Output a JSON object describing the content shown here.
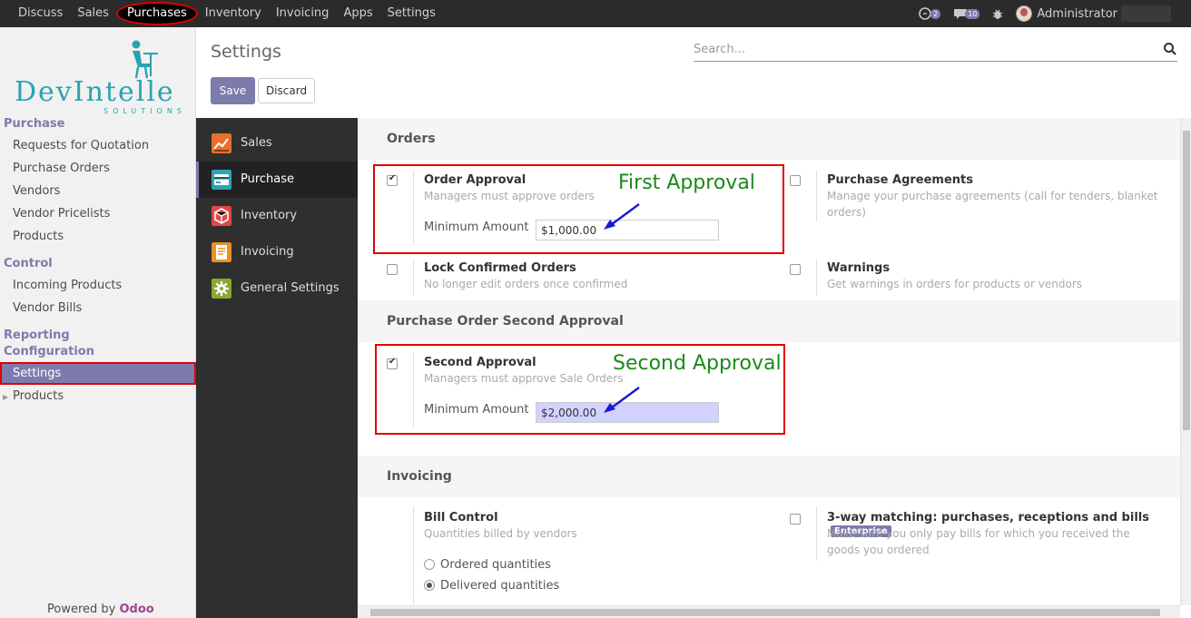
{
  "topbar": {
    "menu": [
      "Discuss",
      "Sales",
      "Purchases",
      "Inventory",
      "Invoicing",
      "Apps",
      "Settings"
    ],
    "active_menu": "Purchases",
    "chat_count": "2",
    "message_count": "10",
    "user": "Administrator"
  },
  "sidebar": {
    "logo_text": "DevIntelle",
    "logo_sub": "SOLUTIONS",
    "sections": [
      {
        "title": "Purchase",
        "items": [
          "Requests for Quotation",
          "Purchase Orders",
          "Vendors",
          "Vendor Pricelists",
          "Products"
        ]
      },
      {
        "title": "Control",
        "items": [
          "Incoming Products",
          "Vendor Bills"
        ]
      },
      {
        "title": "Reporting",
        "items": []
      },
      {
        "title": "Configuration",
        "items": [
          "Settings",
          "Products"
        ]
      }
    ],
    "active_item": "Settings",
    "powered_by": "Powered by",
    "powered_brand": "Odoo"
  },
  "control_panel": {
    "title": "Settings",
    "search_placeholder": "Search...",
    "save_label": "Save",
    "discard_label": "Discard"
  },
  "apps": [
    {
      "label": "Sales",
      "icon": "chart-icon",
      "color": "#e8702a"
    },
    {
      "label": "Purchase",
      "icon": "credit-card-icon",
      "color": "#2fa3b5"
    },
    {
      "label": "Inventory",
      "icon": "box-icon",
      "color": "#e04848"
    },
    {
      "label": "Invoicing",
      "icon": "document-icon",
      "color": "#e8902a"
    },
    {
      "label": "General Settings",
      "icon": "gear-icon",
      "color": "#8aa832"
    }
  ],
  "selected_app": "Purchase",
  "orders": {
    "heading": "Orders",
    "order_approval": {
      "title": "Order Approval",
      "desc": "Managers must approve orders",
      "min_label": "Minimum Amount",
      "min_value": "$1,000.00",
      "checked": true
    },
    "purchase_agreements": {
      "title": "Purchase Agreements",
      "desc": "Manage your purchase agreements (call for tenders, blanket orders)",
      "checked": false
    },
    "lock_confirmed": {
      "title": "Lock Confirmed Orders",
      "desc": "No longer edit orders once confirmed",
      "checked": false
    },
    "warnings": {
      "title": "Warnings",
      "desc": "Get warnings in orders for products or vendors",
      "checked": false
    }
  },
  "second_approval_section": {
    "heading": "Purchase Order Second Approval",
    "second_approval": {
      "title": "Second Approval",
      "desc": "Managers must approve Sale Orders",
      "min_label": "Minimum Amount",
      "min_value": "$2,000.00",
      "checked": true
    }
  },
  "invoicing": {
    "heading": "Invoicing",
    "bill_control": {
      "title": "Bill Control",
      "desc": "Quantities billed by vendors",
      "options": [
        "Ordered quantities",
        "Delivered quantities"
      ],
      "selected": "Delivered quantities"
    },
    "three_way": {
      "title": "3-way matching: purchases, receptions and bills",
      "badge": "Enterprise",
      "desc": "Make sure you only pay bills for which you received the goods you ordered",
      "checked": false
    }
  },
  "annotations": {
    "first": "First Approval",
    "second": "Second Approval"
  }
}
